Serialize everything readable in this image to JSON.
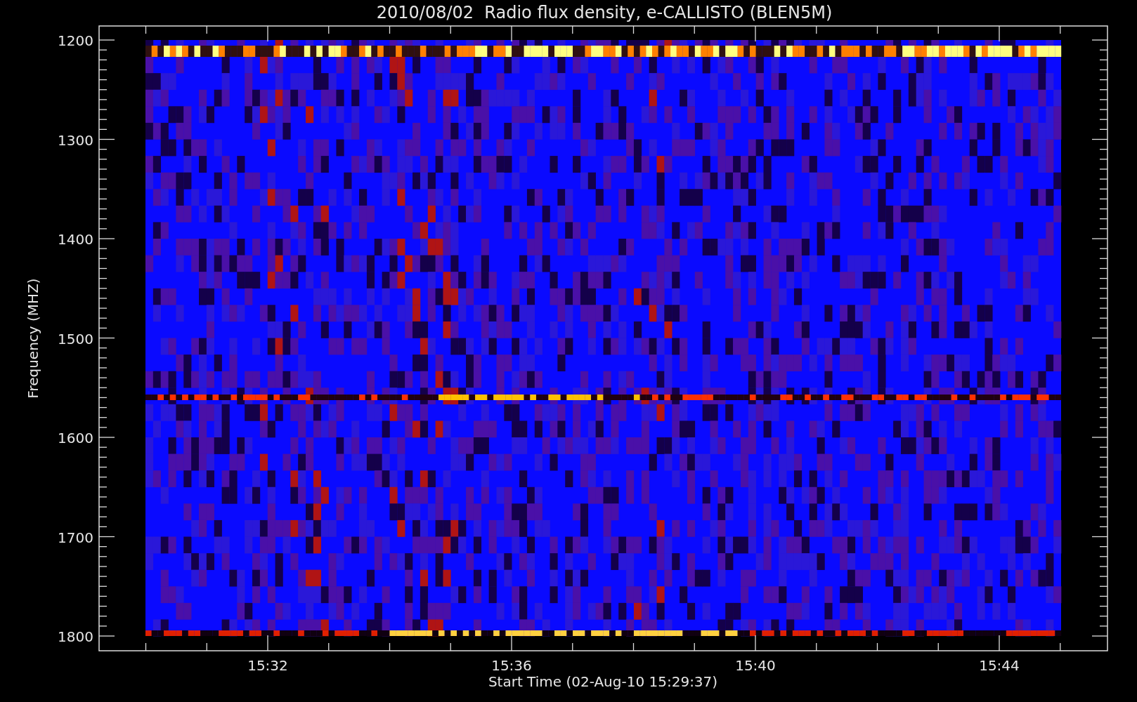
{
  "title": "2010/08/02  Radio flux density, e-CALLISTO (BLEN5M)",
  "y_axis": {
    "label": "Frequency (MHZ)",
    "ticks": [
      "1200",
      "1300",
      "1400",
      "1500",
      "1600",
      "1700",
      "1800"
    ]
  },
  "x_axis": {
    "label": "Start Time (02-Aug-10 15:29:37)",
    "ticks": [
      "15:32",
      "15:36",
      "15:40",
      "15:44"
    ]
  }
}
